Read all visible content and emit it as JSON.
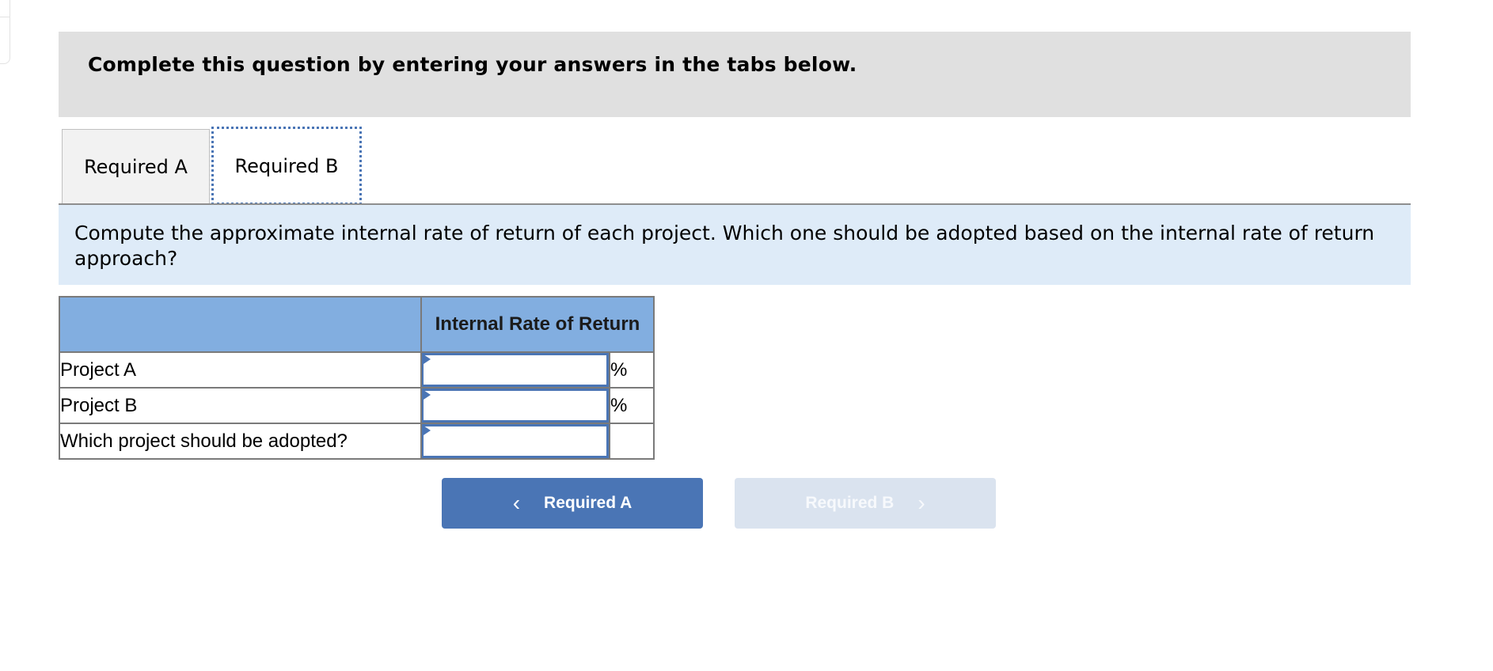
{
  "banner": {
    "text": "Complete this question by entering your answers in the tabs below."
  },
  "tabs": [
    {
      "label": "Required A",
      "active": false
    },
    {
      "label": "Required B",
      "active": true
    }
  ],
  "instructions": "Compute the approximate internal rate of return of each project. Which one should be adopted based on the internal rate of return approach?",
  "table": {
    "headers": [
      "",
      "Internal Rate of Return",
      ""
    ],
    "rows": [
      {
        "label": "Project A",
        "value": "",
        "unit": "%"
      },
      {
        "label": "Project B",
        "value": "",
        "unit": "%"
      },
      {
        "label": "Which project should be adopted?",
        "value": "",
        "unit": ""
      }
    ]
  },
  "nav": {
    "prev": {
      "label": "Required A",
      "icon": "chevron-left-icon",
      "glyph": "‹"
    },
    "next": {
      "label": "Required B",
      "icon": "chevron-right-icon",
      "glyph": "›",
      "disabled": true
    }
  },
  "colors": {
    "accent": "#4a75b5",
    "header_bg": "#82aee0",
    "instruction_bg": "#deebf8",
    "banner_bg": "#e0e0e0"
  }
}
